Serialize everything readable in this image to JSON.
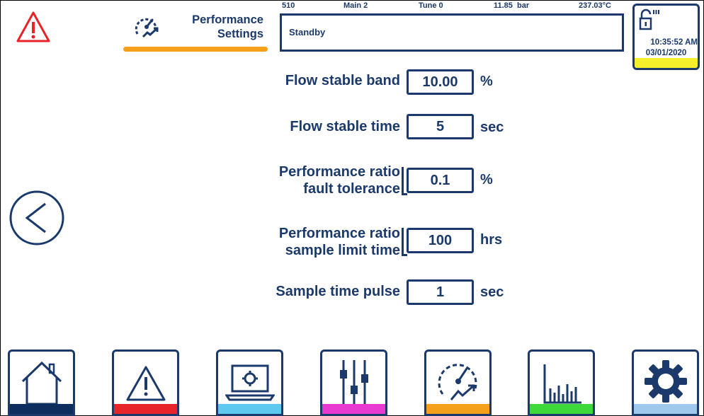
{
  "header": {
    "title_line1": "Performance",
    "title_line2": "Settings",
    "status": {
      "id": "510",
      "mode": "Main 2",
      "tune": "Tune 0",
      "pressure": "11.85  bar",
      "temperature": "237.03°C",
      "state": "Standby"
    },
    "time": "10:35:52 AM",
    "date": "03/01/2020"
  },
  "settings": [
    {
      "label_lines": [
        "Flow stable band"
      ],
      "value": "10.00",
      "unit": "%"
    },
    {
      "label_lines": [
        "Flow stable time"
      ],
      "value": "5",
      "unit": "sec"
    },
    {
      "label_lines": [
        "Performance ratio",
        "fault tolerance"
      ],
      "value": "0.1",
      "unit": "%"
    },
    {
      "label_lines": [
        "Performance ratio",
        "sample limit time"
      ],
      "value": "100",
      "unit": "hrs"
    },
    {
      "label_lines": [
        "Sample time pulse"
      ],
      "value": "1",
      "unit": "sec"
    }
  ],
  "nav": [
    {
      "icon": "home-icon",
      "color": "#0d2d5e"
    },
    {
      "icon": "alarm-icon",
      "color": "#e8232a"
    },
    {
      "icon": "laptop-gear-icon",
      "color": "#5ec8ee"
    },
    {
      "icon": "sliders-icon",
      "color": "#e83ad0"
    },
    {
      "icon": "performance-gauge-icon",
      "color": "#f5a01a"
    },
    {
      "icon": "bar-chart-icon",
      "color": "#3fd83a"
    },
    {
      "icon": "settings-gear-icon",
      "color": "#9ec9ec"
    }
  ],
  "colors": {
    "navy": "#1b3a6b",
    "alarm_red": "#e8232a",
    "header_accent": "#f5a01a",
    "lock_stripe": "#f5ee2a"
  }
}
